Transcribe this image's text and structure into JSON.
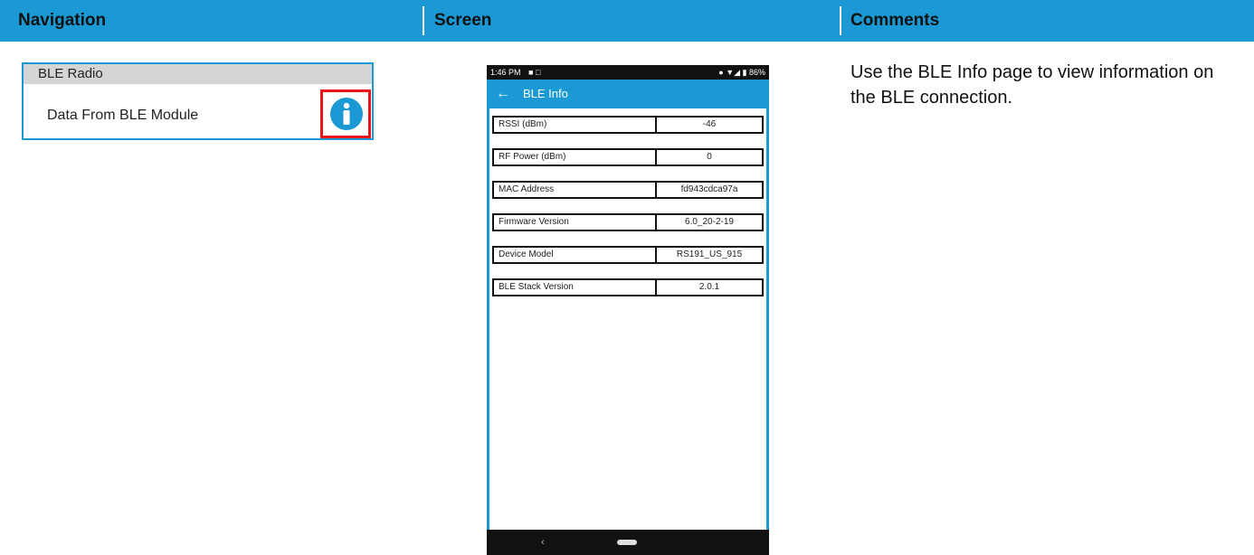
{
  "header": {
    "navigation": "Navigation",
    "screen": "Screen",
    "comments": "Comments"
  },
  "nav": {
    "section_title": "BLE Radio",
    "item_label": "Data From BLE Module",
    "item_icon": "info-icon",
    "highlight_color": "#e8151b"
  },
  "phone": {
    "status_time": "1:46 PM",
    "status_icons": "■ □",
    "status_right": "● ▼◢ ▮ 86%",
    "back": "←",
    "title": "BLE Info",
    "rows": [
      {
        "label": "RSSI (dBm)",
        "value": "-46"
      },
      {
        "label": "RF Power (dBm)",
        "value": "0"
      },
      {
        "label": "MAC Address",
        "value": "fd943cdca97a"
      },
      {
        "label": "Firmware Version",
        "value": "6.0_20-2-19"
      },
      {
        "label": "Device Model",
        "value": "RS191_US_915"
      },
      {
        "label": "BLE Stack Version",
        "value": "2.0.1"
      }
    ],
    "nav_back": "‹"
  },
  "comments": {
    "text": "Use the BLE Info page to view information on the BLE connection."
  },
  "colors": {
    "accent": "#1a99d4",
    "highlight": "#e8151b"
  }
}
